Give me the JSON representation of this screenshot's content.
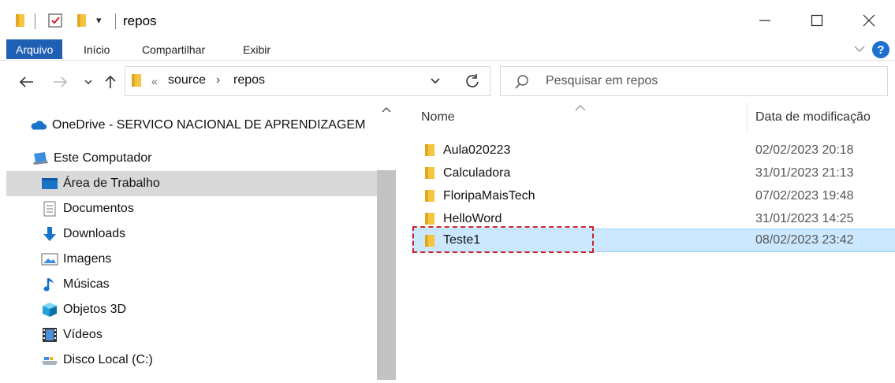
{
  "window": {
    "title": "repos",
    "qa_dropdown": "▾"
  },
  "ribbon": {
    "tabs": [
      {
        "label": "Arquivo",
        "active": true
      },
      {
        "label": "Início"
      },
      {
        "label": "Compartilhar"
      },
      {
        "label": "Exibir"
      }
    ]
  },
  "address": {
    "chevron": "«",
    "crumbs": [
      "source",
      "repos"
    ],
    "separator": "›"
  },
  "search": {
    "placeholder": "Pesquisar em repos"
  },
  "nav": {
    "items": [
      {
        "label": "OneDrive - SERVICO NACIONAL DE APRENDIZAGEM",
        "icon": "cloud-icon"
      },
      {
        "label": "Este Computador",
        "icon": "computer-icon"
      },
      {
        "label": "Área de Trabalho",
        "icon": "desktop-icon",
        "selected": true
      },
      {
        "label": "Documentos",
        "icon": "document-icon"
      },
      {
        "label": "Downloads",
        "icon": "download-arrow-icon"
      },
      {
        "label": "Imagens",
        "icon": "picture-icon"
      },
      {
        "label": "Músicas",
        "icon": "music-note-icon"
      },
      {
        "label": "Objetos 3D",
        "icon": "cube-icon"
      },
      {
        "label": "Vídeos",
        "icon": "film-icon"
      },
      {
        "label": "Disco Local (C:)",
        "icon": "drive-icon"
      }
    ]
  },
  "list": {
    "headers": {
      "name": "Nome",
      "date": "Data de modificação"
    },
    "rows": [
      {
        "name": "Aula020223",
        "date": "02/02/2023 20:18"
      },
      {
        "name": "Calculadora",
        "date": "31/01/2023 21:13"
      },
      {
        "name": "FloripaMaisTech",
        "date": "07/02/2023 19:48"
      },
      {
        "name": "HelloWord",
        "date": "31/01/2023 14:25"
      },
      {
        "name": "Teste1",
        "date": "08/02/2023 23:42",
        "selected": true
      }
    ]
  },
  "colors": {
    "accent": "#1f5fb4",
    "folder": "#f5c542",
    "selection": "#cce8ff",
    "annotation": "#d0202a"
  }
}
